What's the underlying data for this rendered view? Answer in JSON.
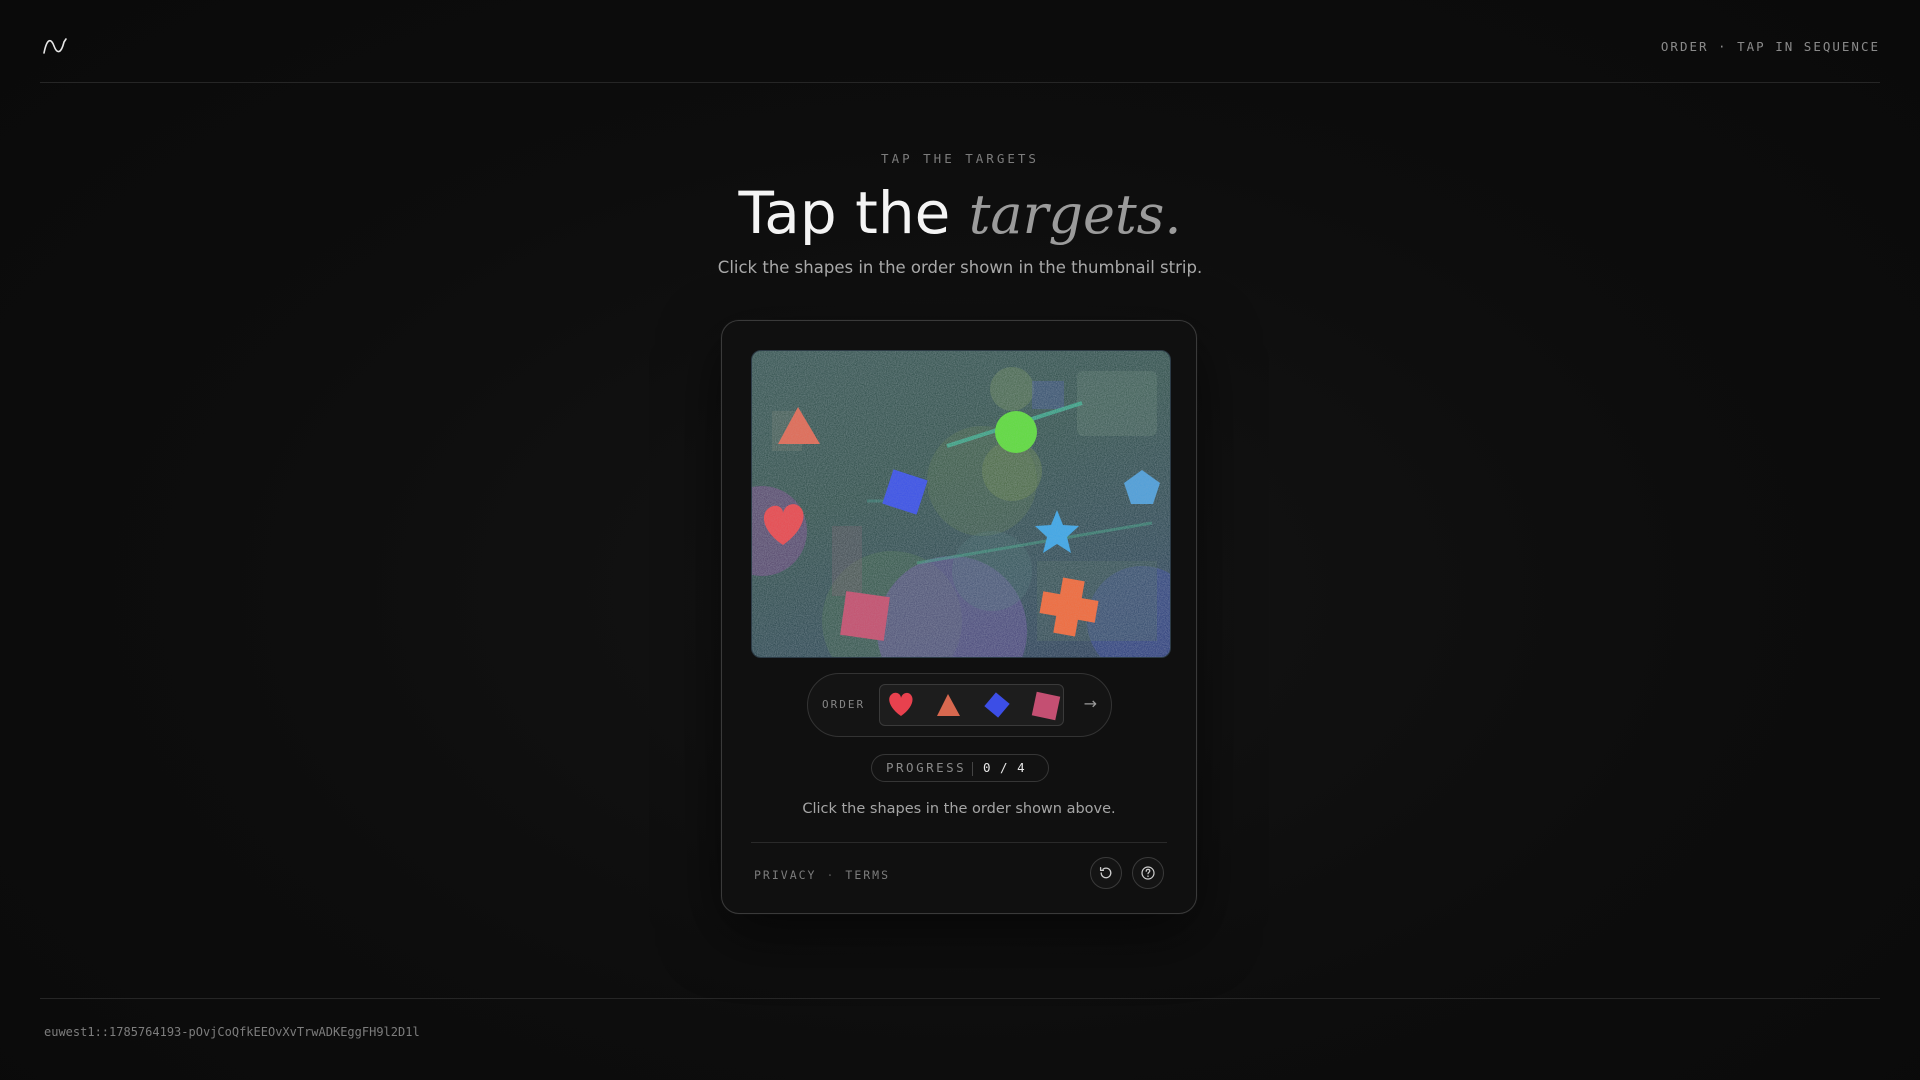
{
  "header": {
    "logo_icon": "wave-logo-icon",
    "right_label": "ORDER · TAP IN SEQUENCE"
  },
  "hero": {
    "eyebrow": "TAP THE TARGETS",
    "title_main": "Tap the ",
    "title_accent": "targets.",
    "subtitle": "Click the shapes in the order shown in the thumbnail strip."
  },
  "challenge": {
    "canvas_shapes": [
      "triangle",
      "square",
      "circle",
      "pentagon",
      "heart",
      "star",
      "square",
      "cross"
    ],
    "canvas_colors": {
      "triangle": "#e06a55",
      "square_blue": "#3c52e6",
      "circle": "#5fdb3e",
      "pentagon": "#4f9ed8",
      "heart": "#e84a4f",
      "star": "#3fa6e6",
      "square_pink": "#c4506e",
      "cross": "#f06a3c"
    },
    "order_label": "ORDER",
    "order_sequence": [
      "heart",
      "triangle",
      "diamond",
      "square"
    ],
    "order_colors": [
      "#e8414e",
      "#d8684f",
      "#3c4ee6",
      "#c44f72"
    ],
    "order_arrow": "→",
    "progress_label": "PROGRESS",
    "progress_value": "0 / 4",
    "hint": "Click the shapes in the order shown above."
  },
  "card_footer": {
    "privacy": "PRIVACY",
    "separator": "·",
    "terms": "TERMS",
    "reload_icon": "reload-icon",
    "help_icon": "help-icon"
  },
  "footer": {
    "session_id": "euwest1::1785764193-pOvjCoQfkEEOvXvTrwADKEggFH9l2D1l"
  }
}
